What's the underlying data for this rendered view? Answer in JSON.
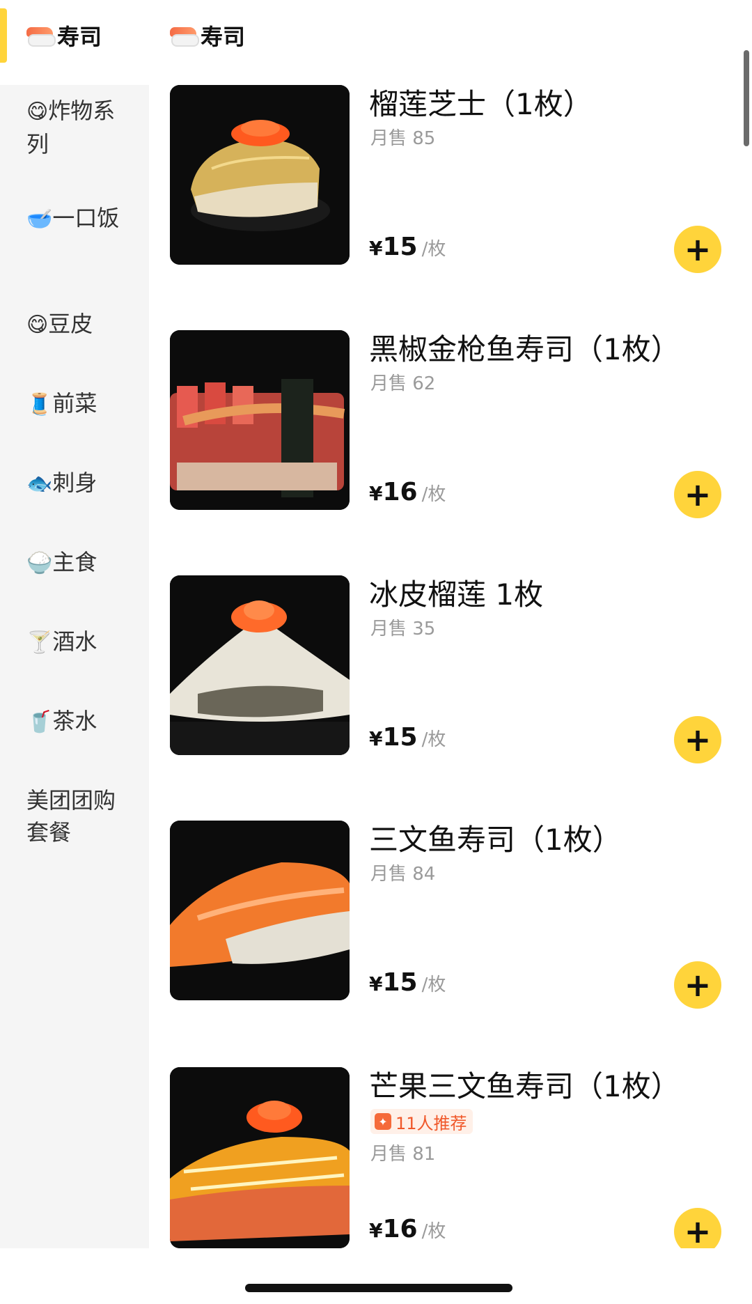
{
  "sidebar": {
    "active": {
      "icon": "sushi-icon",
      "label": "寿司"
    },
    "items": [
      {
        "icon": "yum-face-emoji",
        "emoji": "😋",
        "label": "炸物系列"
      },
      {
        "icon": "rice-bowl-emoji",
        "emoji": "🥣",
        "label": "一口饭"
      },
      {
        "icon": "yum-face-emoji",
        "emoji": "😋",
        "label": "豆皮"
      },
      {
        "icon": "thread-spool-emoji",
        "emoji": "🧵",
        "label": "前菜"
      },
      {
        "icon": "fish-emoji",
        "emoji": "🐟",
        "label": "刺身"
      },
      {
        "icon": "rice-emoji",
        "emoji": "🍚",
        "label": "主食"
      },
      {
        "icon": "cocktail-emoji",
        "emoji": "🍸",
        "label": "酒水"
      },
      {
        "icon": "cup-straw-emoji",
        "emoji": "🥤",
        "label": "茶水"
      },
      {
        "icon": "",
        "emoji": "",
        "label": "美团团购套餐"
      }
    ]
  },
  "section": {
    "icon": "sushi-icon",
    "title": "寿司"
  },
  "products": [
    {
      "name": "榴莲芝士（1枚）",
      "sales": "月售 85",
      "currency": "¥",
      "price": "15",
      "unit": "/枚",
      "add": "+"
    },
    {
      "name": "黑椒金枪鱼寿司（1枚）",
      "sales": "月售 62",
      "currency": "¥",
      "price": "16",
      "unit": "/枚",
      "add": "+"
    },
    {
      "name": "冰皮榴莲 1枚",
      "sales": "月售 35",
      "currency": "¥",
      "price": "15",
      "unit": "/枚",
      "add": "+"
    },
    {
      "name": "三文鱼寿司（1枚）",
      "sales": "月售 84",
      "currency": "¥",
      "price": "15",
      "unit": "/枚",
      "add": "+"
    },
    {
      "name": "芒果三文鱼寿司（1枚）",
      "badge": "11人推荐",
      "sales": "月售 81",
      "currency": "¥",
      "price": "16",
      "unit": "/枚",
      "add": "+"
    }
  ],
  "colors": {
    "accent": "#ffd43b",
    "badge": "#f0582a",
    "muted": "#9a9a9a"
  }
}
